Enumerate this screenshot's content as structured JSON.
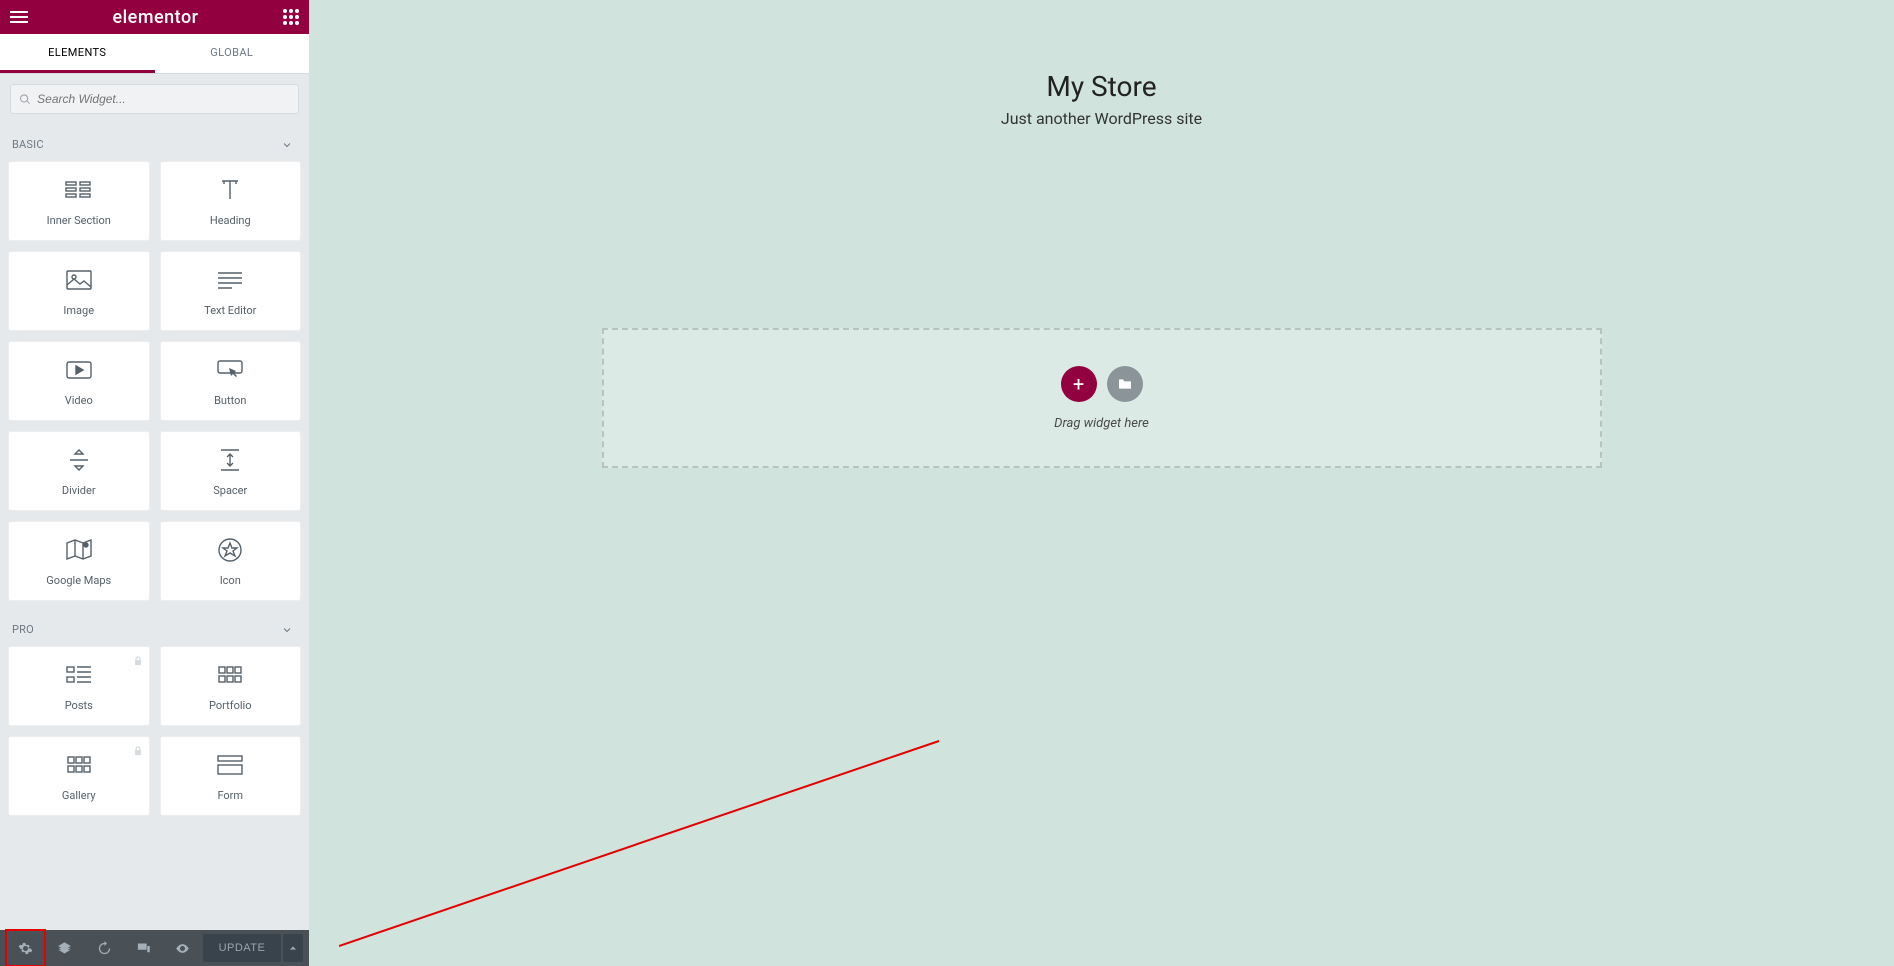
{
  "header": {
    "logo": "elementor"
  },
  "tabs": {
    "elements": "ELEMENTS",
    "global": "GLOBAL"
  },
  "search": {
    "placeholder": "Search Widget..."
  },
  "categories": {
    "basic": {
      "label": "BASIC",
      "widgets": [
        {
          "name": "Inner Section"
        },
        {
          "name": "Heading"
        },
        {
          "name": "Image"
        },
        {
          "name": "Text Editor"
        },
        {
          "name": "Video"
        },
        {
          "name": "Button"
        },
        {
          "name": "Divider"
        },
        {
          "name": "Spacer"
        },
        {
          "name": "Google Maps"
        },
        {
          "name": "Icon"
        }
      ]
    },
    "pro": {
      "label": "PRO",
      "widgets": [
        {
          "name": "Posts",
          "locked": true
        },
        {
          "name": "Portfolio",
          "locked": false
        },
        {
          "name": "Gallery",
          "locked": true
        },
        {
          "name": "Form",
          "locked": false
        }
      ]
    }
  },
  "bottom": {
    "update": "UPDATE"
  },
  "site": {
    "title": "My Store",
    "tagline": "Just another WordPress site"
  },
  "dropzone": {
    "hint": "Drag widget here"
  }
}
